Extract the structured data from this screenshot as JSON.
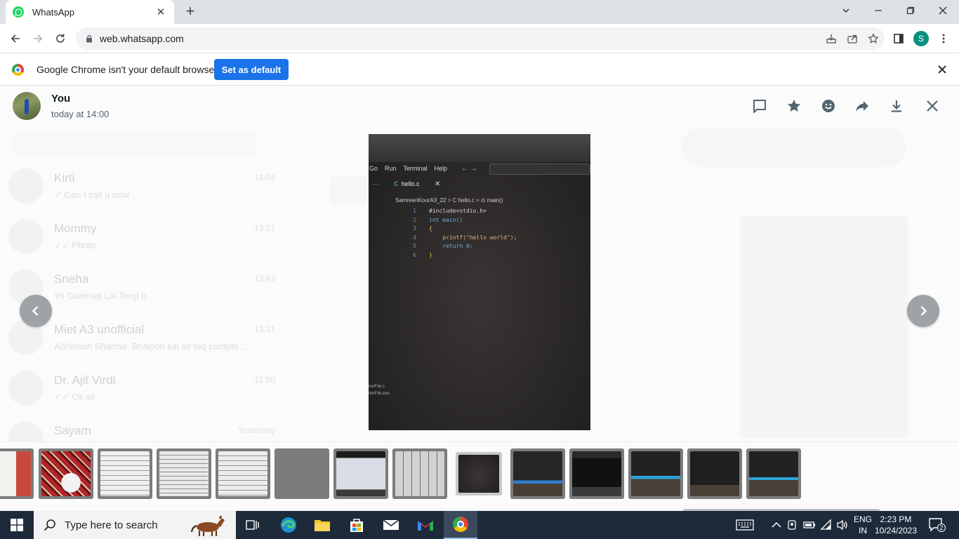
{
  "browser": {
    "tab_title": "WhatsApp",
    "url": "web.whatsapp.com",
    "profile_initial": "S"
  },
  "infobar": {
    "message": "Google Chrome isn't your default browser",
    "button_label": "Set as default"
  },
  "viewer": {
    "sender": "You",
    "timestamp": "today at 14:00",
    "header_icons": [
      "reply-icon",
      "star-icon",
      "emoji-react-icon",
      "forward-icon",
      "download-icon",
      "close-icon"
    ]
  },
  "photo": {
    "menu": [
      "Go",
      "Run",
      "Terminal",
      "Help"
    ],
    "tab_file": "hello.c",
    "tab_lang": "C",
    "breadcrumb": "SamreenKourA3_22 >  C  hello.c >  ⊙ main()",
    "code_lines": [
      {
        "n": "1",
        "text": "#include<stdio.h>"
      },
      {
        "n": "2",
        "text": "int main()"
      },
      {
        "n": "3",
        "text": "{"
      },
      {
        "n": "4",
        "text": "    printf(\"hello world\");"
      },
      {
        "n": "5",
        "text": "    return 0;"
      },
      {
        "n": "6",
        "text": "}"
      }
    ],
    "side_files": [
      "nerFile.c",
      "nerFile.exe"
    ]
  },
  "background_chats": [
    {
      "name": "Kirti",
      "preview": "✓ Can I call u now",
      "time": "14:04"
    },
    {
      "name": "Mommy",
      "preview": "✓✓ Photo",
      "time": "13:51"
    },
    {
      "name": "Sneha",
      "preview": "Yo Gammat Lai Tergi h",
      "time": "13:43"
    },
    {
      "name": "Miet A3 unofficial",
      "preview": "Abhinash Sharma: Bhaiyon kal se teq compte...",
      "time": "13:31"
    },
    {
      "name": "Dr. Ajit Virdi",
      "preview": "✓✓ Ok sir",
      "time": "12:50"
    },
    {
      "name": "Sayam",
      "preview": "",
      "time": "Yesterday"
    }
  ],
  "thumbnails": [
    {
      "kind": "paper-red",
      "selected": false
    },
    {
      "kind": "fabric-card",
      "selected": false
    },
    {
      "kind": "notes",
      "selected": false
    },
    {
      "kind": "notes",
      "selected": false
    },
    {
      "kind": "notes",
      "selected": false
    },
    {
      "kind": "notes-dark",
      "selected": false
    },
    {
      "kind": "screen-light",
      "selected": false
    },
    {
      "kind": "lines",
      "selected": false
    },
    {
      "kind": "code-dark",
      "selected": true
    },
    {
      "kind": "screen-code",
      "selected": false
    },
    {
      "kind": "screen-code",
      "selected": false
    },
    {
      "kind": "screen-code-blue",
      "selected": false
    },
    {
      "kind": "screen-code",
      "selected": false
    },
    {
      "kind": "screen-code-blue",
      "selected": false
    }
  ],
  "taskbar": {
    "search_placeholder": "Type here to search",
    "language_line1": "ENG",
    "language_line2": "IN",
    "time": "2:23 PM",
    "date": "10/24/2023",
    "notification_count": "2"
  },
  "colors": {
    "whatsapp_green": "#25d366",
    "chrome_blue": "#1a73e8",
    "taskbar": "#1c2a3a"
  }
}
